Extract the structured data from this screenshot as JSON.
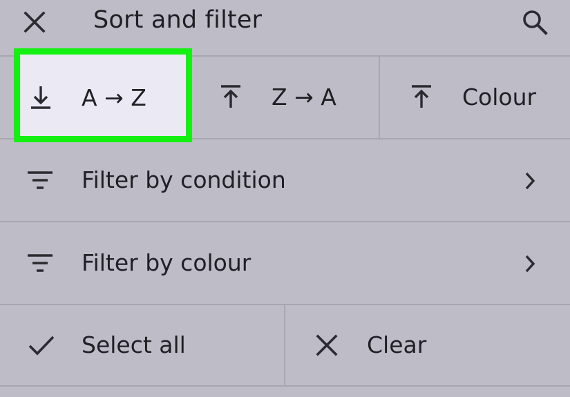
{
  "header": {
    "close_icon": "close-icon",
    "title": "Sort and filter",
    "search_icon": "search-icon"
  },
  "sort": {
    "az": {
      "label": "A → Z",
      "icon": "sort-download-icon"
    },
    "za": {
      "label": "Z → A",
      "icon": "sort-upload-icon"
    },
    "colour": {
      "label": "Colour",
      "icon": "sort-upload-icon"
    }
  },
  "filters": {
    "condition": {
      "label": "Filter by condition",
      "icon": "filter-lines-icon",
      "chevron": "chevron-right-icon"
    },
    "colour": {
      "label": "Filter by colour",
      "icon": "filter-lines-icon",
      "chevron": "chevron-right-icon"
    }
  },
  "actions": {
    "select_all": {
      "label": "Select all",
      "icon": "check-icon"
    },
    "clear": {
      "label": "Clear",
      "icon": "close-icon"
    }
  },
  "colors": {
    "background": "#bdbcc7",
    "divider": "#a7a6b1",
    "highlight_border": "#15f013",
    "highlight_fill": "#ebeaf4",
    "text": "#1f1f24"
  }
}
